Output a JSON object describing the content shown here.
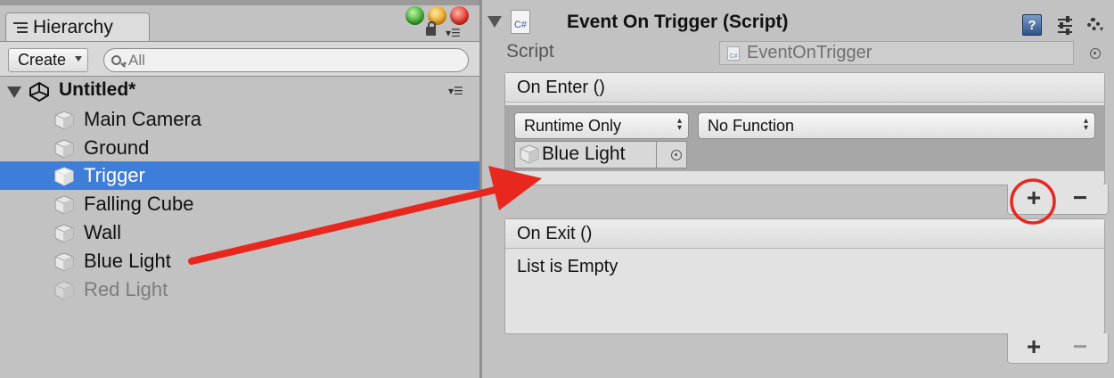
{
  "hierarchy": {
    "tab_label": "Hierarchy",
    "create_label": "Create",
    "search_placeholder": "All",
    "scene_name": "Untitled*",
    "items": [
      {
        "label": "Main Camera"
      },
      {
        "label": "Ground"
      },
      {
        "label": "Trigger"
      },
      {
        "label": "Falling Cube"
      },
      {
        "label": "Wall"
      },
      {
        "label": "Blue Light"
      },
      {
        "label": "Red Light"
      }
    ],
    "selected_item": "Trigger",
    "inactive_item": "Red Light"
  },
  "inspector": {
    "component_title": "Event On Trigger (Script)",
    "cs_icon_text": "C#",
    "script_label": "Script",
    "script_value": "EventOnTrigger",
    "on_enter": {
      "title": "On Enter ()",
      "runtime_option": "Runtime Only",
      "function_option": "No Function",
      "target_object": "Blue Light"
    },
    "on_exit": {
      "title": "On Exit ()",
      "empty_text": "List is Empty"
    },
    "add_label": "+",
    "remove_label": "−",
    "help_label": "?"
  },
  "colors": {
    "selection": "#3e7ed8",
    "annotation_red": "#e8281e",
    "panel_bg": "#c2c2c2"
  },
  "icons": [
    "hierarchy-menu-icon",
    "search-icon",
    "unity-logo-icon",
    "cube-icon",
    "csharp-script-icon",
    "help-icon",
    "preset-icon",
    "gear-icon",
    "target-icon"
  ]
}
